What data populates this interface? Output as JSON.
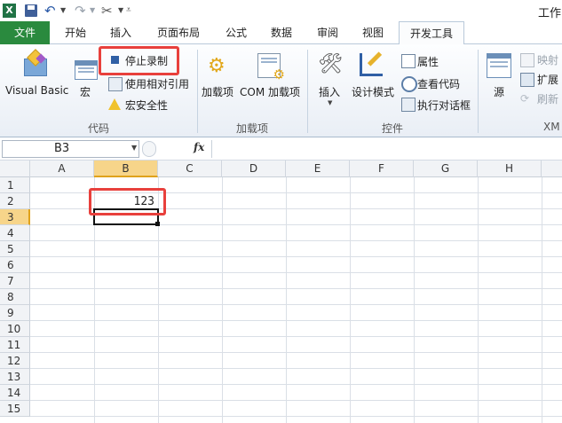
{
  "window": {
    "title_partial": "工作"
  },
  "tabs": [
    {
      "label": "文件"
    },
    {
      "label": "开始"
    },
    {
      "label": "插入"
    },
    {
      "label": "页面布局"
    },
    {
      "label": "公式"
    },
    {
      "label": "数据"
    },
    {
      "label": "审阅"
    },
    {
      "label": "视图"
    },
    {
      "label": "开发工具"
    }
  ],
  "active_tab": "开发工具",
  "ribbon": {
    "code": {
      "label": "代码",
      "visual_basic": "Visual Basic",
      "macros": "宏",
      "stop_recording": "停止录制",
      "relative_ref": "使用相对引用",
      "macro_security": "宏安全性"
    },
    "addins": {
      "label": "加载项",
      "addins": "加载项",
      "com_addins": "COM 加载项"
    },
    "controls": {
      "label": "控件",
      "insert": "插入",
      "design_mode": "设计模式",
      "properties": "属性",
      "view_code": "查看代码",
      "run_dialog": "执行对话框"
    },
    "xml": {
      "label": "XM",
      "source": "源",
      "map_props": "映射",
      "expansion": "扩展",
      "refresh": "刷新"
    }
  },
  "formula_bar": {
    "name_box": "B3",
    "fx": "fx",
    "formula": ""
  },
  "columns": [
    "A",
    "B",
    "C",
    "D",
    "E",
    "F",
    "G",
    "H"
  ],
  "rows": [
    "1",
    "2",
    "3",
    "4",
    "5",
    "6",
    "7",
    "8",
    "9",
    "10",
    "11",
    "12",
    "13",
    "14",
    "15"
  ],
  "cells": {
    "B2": "123"
  },
  "selected_cell": "B3",
  "accent": {
    "file_tab": "#2a8a3e",
    "highlight": "#e8403c",
    "selected_header": "#f7d58a"
  }
}
